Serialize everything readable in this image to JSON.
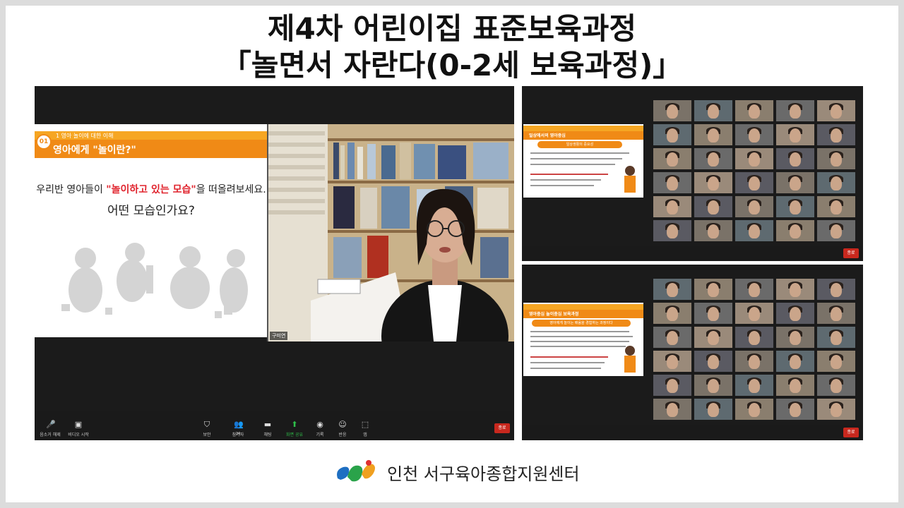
{
  "slide": {
    "title_line1": "제4차 어린이집 표준보육과정",
    "title_line2": "「놀면서 자란다(0-2세 보육과정)」",
    "footer": "인천 서구육아종합지원센터"
  },
  "main_panel": {
    "section_number": "01",
    "section_category": "1 영아 놀이에 대한 이해",
    "section_title": "영아에게 \"놀이란?\"",
    "question_prefix": "우리반 영아들이 ",
    "question_highlight": "\"놀이하고 있는 모습\"",
    "question_suffix": "을 떠올려보세요.",
    "question_line2": "어떤 모습인가요?",
    "speaker_name": "구미연",
    "toolbar": {
      "mute": "음소거 해제",
      "video": "비디오 시작",
      "security": "보안",
      "participants": "참가자",
      "participants_count": "24",
      "chat": "채팅",
      "share": "화면 공유",
      "record": "기록",
      "reactions": "반응",
      "apps": "앱",
      "end": "종료"
    }
  },
  "panel_top": {
    "slide_title": "일상에서의 영아중심",
    "pill": "일상생활의 중요성"
  },
  "panel_bottom": {
    "slide_title": "영아중심 놀이중심 보육과정",
    "pill": "영아에게 놀이는 배움을 경험하는 과정이다"
  },
  "colors": {
    "accent_orange": "#f08a16",
    "light_orange": "#f6a623",
    "highlight_red": "#e0222c",
    "zoom_bg": "#1b1b1b",
    "end_red": "#c8281e"
  }
}
